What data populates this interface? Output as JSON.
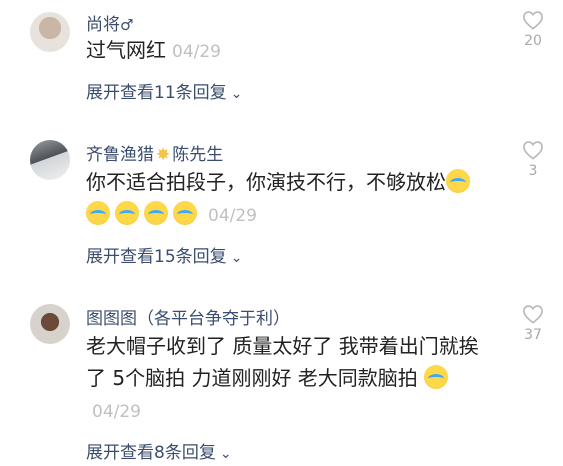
{
  "comments": [
    {
      "username": "尚将",
      "gender_symbol": "♂",
      "text": "过气网红",
      "time": "04/29",
      "expand": "展开查看11条回复",
      "likes": "20"
    },
    {
      "username": "齐鲁渔猎",
      "username_suffix": "陈先生",
      "badge": "sparkle-badge",
      "text": "你不适合拍段子，你演技不行，不够放松",
      "emoji_count": 5,
      "time": "04/29",
      "expand": "展开查看15条回复",
      "likes": "3"
    },
    {
      "username": "图图图（各平台争夺于利）",
      "text": "老大帽子收到了 质量太好了 我带着出门就挨了 5个脑拍 力道刚刚好 老大同款脑拍",
      "emoji_count": 1,
      "time": "04/29",
      "expand": "展开查看8条回复",
      "likes": "37"
    }
  ],
  "icons": {
    "like": "heart-outline-icon",
    "expand": "chevron-down-icon",
    "emoji": "crying-laughing-emoji"
  },
  "colors": {
    "username": "#3b4d6e",
    "timestamp": "#c0c0c0",
    "like_count": "#a8a8a8"
  }
}
